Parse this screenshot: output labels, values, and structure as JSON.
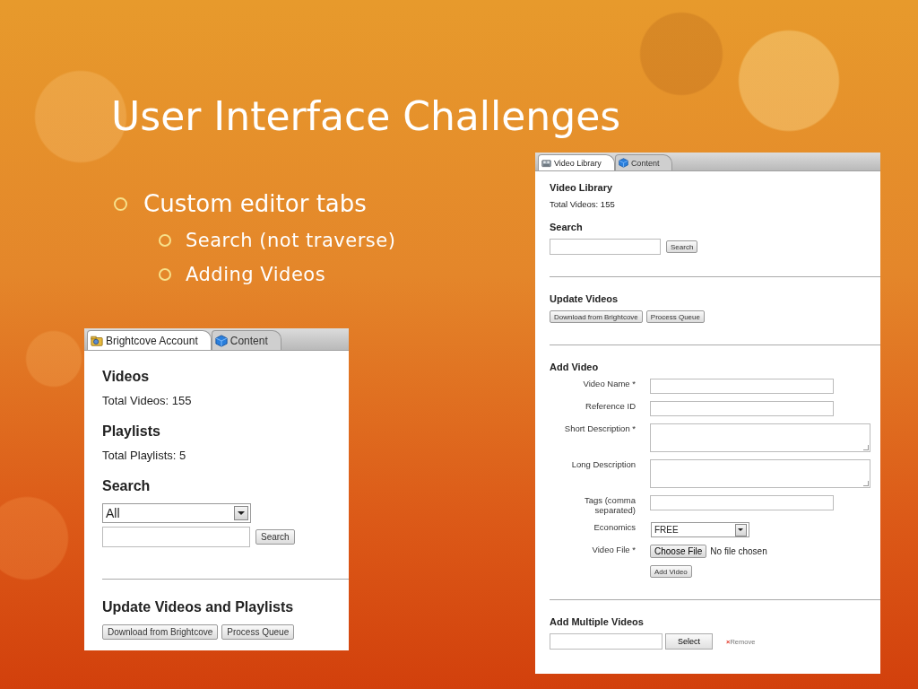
{
  "slide": {
    "title": "User Interface Challenges",
    "bullets": [
      {
        "text": "Custom editor tabs",
        "children": [
          {
            "text": "Search (not traverse)"
          },
          {
            "text": "Adding Videos"
          }
        ]
      }
    ]
  },
  "left_panel": {
    "tabs": [
      {
        "label": "Brightcove Account",
        "kind": "account",
        "selected": true
      },
      {
        "label": "Content",
        "kind": "content",
        "selected": false
      }
    ],
    "items": [
      {
        "kind": "heading",
        "text": "Videos"
      },
      {
        "kind": "text",
        "text": "Total Videos: 155"
      },
      {
        "kind": "heading",
        "text": "Playlists"
      },
      {
        "kind": "text",
        "text": "Total Playlists: 5"
      },
      {
        "kind": "heading",
        "text": "Search"
      },
      {
        "kind": "select",
        "value": "All"
      },
      {
        "kind": "search",
        "button": "Search"
      },
      {
        "kind": "divider"
      },
      {
        "kind": "heading",
        "text": "Update Videos and Playlists"
      },
      {
        "kind": "buttons",
        "buttons": [
          "Download from Brightcove",
          "Process Queue"
        ]
      }
    ]
  },
  "right_panel": {
    "tabs": [
      {
        "label": "Video Library",
        "kind": "library",
        "selected": true
      },
      {
        "label": "Content",
        "kind": "content",
        "selected": false
      }
    ],
    "items": [
      {
        "kind": "heading",
        "text": "Video Library"
      },
      {
        "kind": "text",
        "text": "Total Videos: 155"
      },
      {
        "kind": "heading",
        "text": "Search"
      },
      {
        "kind": "search",
        "button": "Search"
      },
      {
        "kind": "divider"
      },
      {
        "kind": "heading",
        "text": "Update Videos"
      },
      {
        "kind": "buttons",
        "buttons": [
          "Download from Brightcove",
          "Process Queue"
        ]
      },
      {
        "kind": "divider"
      },
      {
        "kind": "heading",
        "text": "Add Video"
      },
      {
        "kind": "form_row",
        "label": "Video Name *",
        "control": {
          "kind": "input"
        }
      },
      {
        "kind": "form_row",
        "label": "Reference ID",
        "control": {
          "kind": "input"
        }
      },
      {
        "kind": "form_row",
        "label": "Short Description *",
        "control": {
          "kind": "textarea"
        }
      },
      {
        "kind": "form_row",
        "label": "Long Description",
        "control": {
          "kind": "textarea"
        }
      },
      {
        "kind": "form_row",
        "label": "Tags (comma separated)",
        "control": {
          "kind": "input"
        }
      },
      {
        "kind": "form_row",
        "label": "Economics",
        "control": {
          "kind": "select",
          "value": "FREE"
        }
      },
      {
        "kind": "form_row",
        "label": "Video File *",
        "control": {
          "kind": "file",
          "button": "Choose File",
          "status": "No file chosen"
        }
      },
      {
        "kind": "form_button",
        "label": "Add Video"
      },
      {
        "kind": "divider"
      },
      {
        "kind": "heading",
        "text": "Add Multiple Videos"
      },
      {
        "kind": "multi",
        "button": "Select",
        "remove": "Remove",
        "remove_icon": "×"
      }
    ]
  }
}
